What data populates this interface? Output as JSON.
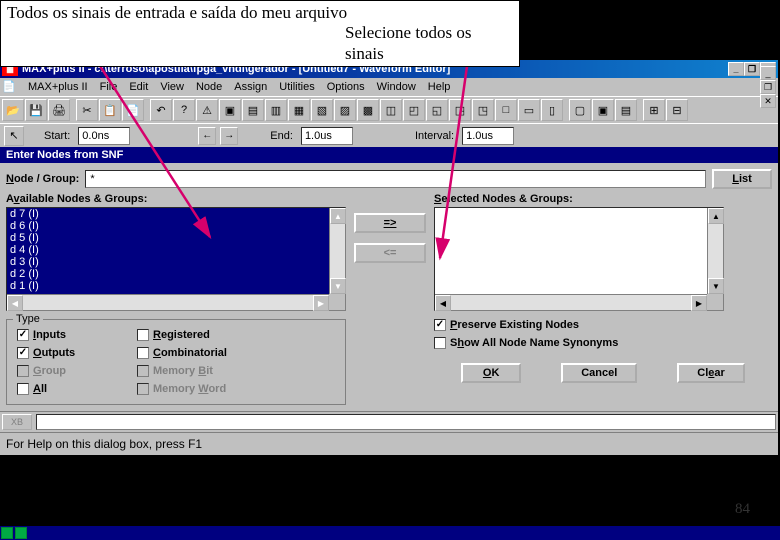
{
  "annotation": {
    "line1": "Todos os sinais de entrada e saída do meu arquivo",
    "line2": "Selecione todos os sinais"
  },
  "titlebar": {
    "app_icon_text": "MAX",
    "title": "MAX+plus II - c:\\terroso\\apostila\\fpga_vhdl\\gerador - [Untitled7 - Waveform Editor]"
  },
  "window_buttons": {
    "min": "_",
    "max": "❐",
    "close": "✕"
  },
  "menubar": {
    "items": [
      "MAX+plus II",
      "File",
      "Edit",
      "View",
      "Node",
      "Assign",
      "Utilities",
      "Options",
      "Window",
      "Help"
    ]
  },
  "toolbar_icons": [
    "open",
    "save",
    "print",
    "",
    "cut",
    "copy",
    "paste",
    "",
    "undo",
    "help",
    "warn",
    "chip",
    "a",
    "b",
    "c",
    "d",
    "e",
    "f",
    "g",
    "h",
    "i",
    "j",
    "k",
    "l",
    "m",
    "n",
    "",
    "o1",
    "o2",
    "o3",
    "",
    "p1",
    "p2"
  ],
  "time": {
    "start_label": "Start:",
    "start_value": "0.0ns",
    "end_label": "End:",
    "end_value": "1.0us",
    "interval_label": "Interval:",
    "interval_value": "1.0us"
  },
  "dialog": {
    "title": "Enter Nodes from SNF",
    "node_group_label": "Node / Group:",
    "node_group_value": "*",
    "list_button": "List",
    "available_label": "Available Nodes & Groups:",
    "selected_label": "Selected Nodes & Groups:",
    "available_items": [
      "d 7 (I)",
      "d 6 (I)",
      "d 5 (I)",
      "d 4 (I)",
      "d 3 (I)",
      "d 2 (I)",
      "d 1 (I)"
    ],
    "add_button": "=>",
    "remove_button": "<=",
    "type_legend": "Type",
    "type_options": [
      {
        "label": "Inputs",
        "checked": true,
        "enabled": true,
        "u": "I"
      },
      {
        "label": "Registered",
        "checked": false,
        "enabled": true,
        "u": "R"
      },
      {
        "label": "Outputs",
        "checked": true,
        "enabled": true,
        "u": "O"
      },
      {
        "label": "Combinatorial",
        "checked": false,
        "enabled": true,
        "u": "C"
      },
      {
        "label": "Group",
        "checked": false,
        "enabled": false,
        "u": "G"
      },
      {
        "label": "Memory Bit",
        "checked": false,
        "enabled": false,
        "u": "B"
      },
      {
        "label": "All",
        "checked": false,
        "enabled": true,
        "u": "A"
      },
      {
        "label": "Memory Word",
        "checked": false,
        "enabled": false,
        "u": "W"
      }
    ],
    "preserve_label": "Preserve Existing Nodes",
    "preserve_checked": true,
    "show_syn_label": "Show All Node Name Synonyms",
    "show_syn_checked": false,
    "ok_button": "OK",
    "cancel_button": "Cancel",
    "clear_button": "Clear"
  },
  "xb_button": "XB",
  "status_text": "For Help on this dialog box, press F1",
  "slide_number": "84"
}
